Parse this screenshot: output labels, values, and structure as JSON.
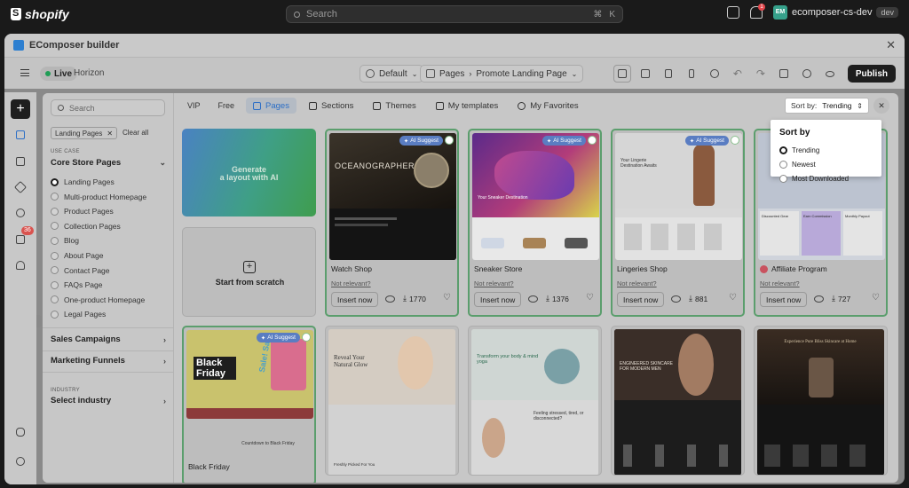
{
  "shopify": {
    "logo_text": "shopify",
    "search_placeholder": "Search",
    "shortcut": [
      "⌘",
      "K"
    ],
    "notification_count": "1",
    "avatar_initials": "EM",
    "store_name": "ecomposer-cs-dev",
    "store_tag": "dev"
  },
  "app": {
    "title": "EComposer builder",
    "status": "Live",
    "theme": "Horizon",
    "language": "Default",
    "page_type": "Pages",
    "page_name": "Promote Landing Page",
    "publish_label": "Publish"
  },
  "rail": {
    "badge": "36"
  },
  "filters": {
    "search_placeholder": "Search",
    "active_chip": "Landing Pages",
    "clear_all": "Clear all",
    "use_case_label": "USE CASE",
    "use_case_title": "Core Store Pages",
    "options": [
      {
        "label": "Landing Pages",
        "selected": true
      },
      {
        "label": "Multi-product Homepage",
        "selected": false
      },
      {
        "label": "Product Pages",
        "selected": false
      },
      {
        "label": "Collection Pages",
        "selected": false
      },
      {
        "label": "Blog",
        "selected": false
      },
      {
        "label": "About Page",
        "selected": false
      },
      {
        "label": "Contact Page",
        "selected": false
      },
      {
        "label": "FAQs Page",
        "selected": false
      },
      {
        "label": "One-product Homepage",
        "selected": false
      },
      {
        "label": "Legal Pages",
        "selected": false
      }
    ],
    "sales_campaigns": "Sales Campaigns",
    "marketing_funnels": "Marketing Funnels",
    "industry_label": "INDUSTRY",
    "industry_value": "Select industry"
  },
  "tabs": {
    "vip": "VIP",
    "free": "Free",
    "pages": "Pages",
    "sections": "Sections",
    "themes": "Themes",
    "my_templates": "My templates",
    "my_favorites": "My Favorites"
  },
  "sort": {
    "label": "Sort by:",
    "value": "Trending",
    "menu_title": "Sort by",
    "options": [
      {
        "label": "Trending",
        "selected": true
      },
      {
        "label": "Newest",
        "selected": false
      },
      {
        "label": "Most Downloaded",
        "selected": false
      }
    ]
  },
  "generate": {
    "line1": "Generate",
    "line2": "a layout with AI"
  },
  "scratch_label": "Start from scratch",
  "ai_badge": "AI Suggest",
  "cards": [
    {
      "name": "Watch Shop",
      "not_relevant": "Not relevant?",
      "insert": "Insert now",
      "downloads": "1770",
      "thumb_title": "OCEANOGRAPHER"
    },
    {
      "name": "Sneaker Store",
      "not_relevant": "Not relevant?",
      "insert": "Insert now",
      "downloads": "1376",
      "thumb_title": "Your Sneaker Destination"
    },
    {
      "name": "Lingeries Shop",
      "not_relevant": "Not relevant?",
      "insert": "Insert now",
      "downloads": "881",
      "thumb_title": "Your Lingerie Destination Awaits"
    },
    {
      "name": "Affiliate Program",
      "not_relevant": "Not relevant?",
      "insert": "Insert now",
      "downloads": "727",
      "thumb_labels": [
        "Discounted Gear",
        "Earn Commission",
        "Monthly Payout"
      ]
    }
  ],
  "row2": [
    {
      "name": "Black Friday",
      "thumb_title": "Black Friday",
      "thumb_sub": "Countdown to Black Friday",
      "side": "Sale! Sale!"
    },
    {
      "thumb_title": "Reveal Your Natural Glow",
      "thumb_sub": "Freshly Picked For You"
    },
    {
      "thumb_title": "Transform your body & mind yoga",
      "thumb_sub": "Feeling stressed, tired, or disconnected?"
    },
    {
      "thumb_title": "ENGINEERED SKINCARE FOR MODERN MEN"
    },
    {
      "thumb_title": "Experience Pure Bliss Skincare at Home"
    }
  ],
  "colors": {
    "accent": "#2d6fc6",
    "ai_badge": "#5a7dc2",
    "suggest_border": "#5b9e6d",
    "live": "#1f9d55"
  }
}
